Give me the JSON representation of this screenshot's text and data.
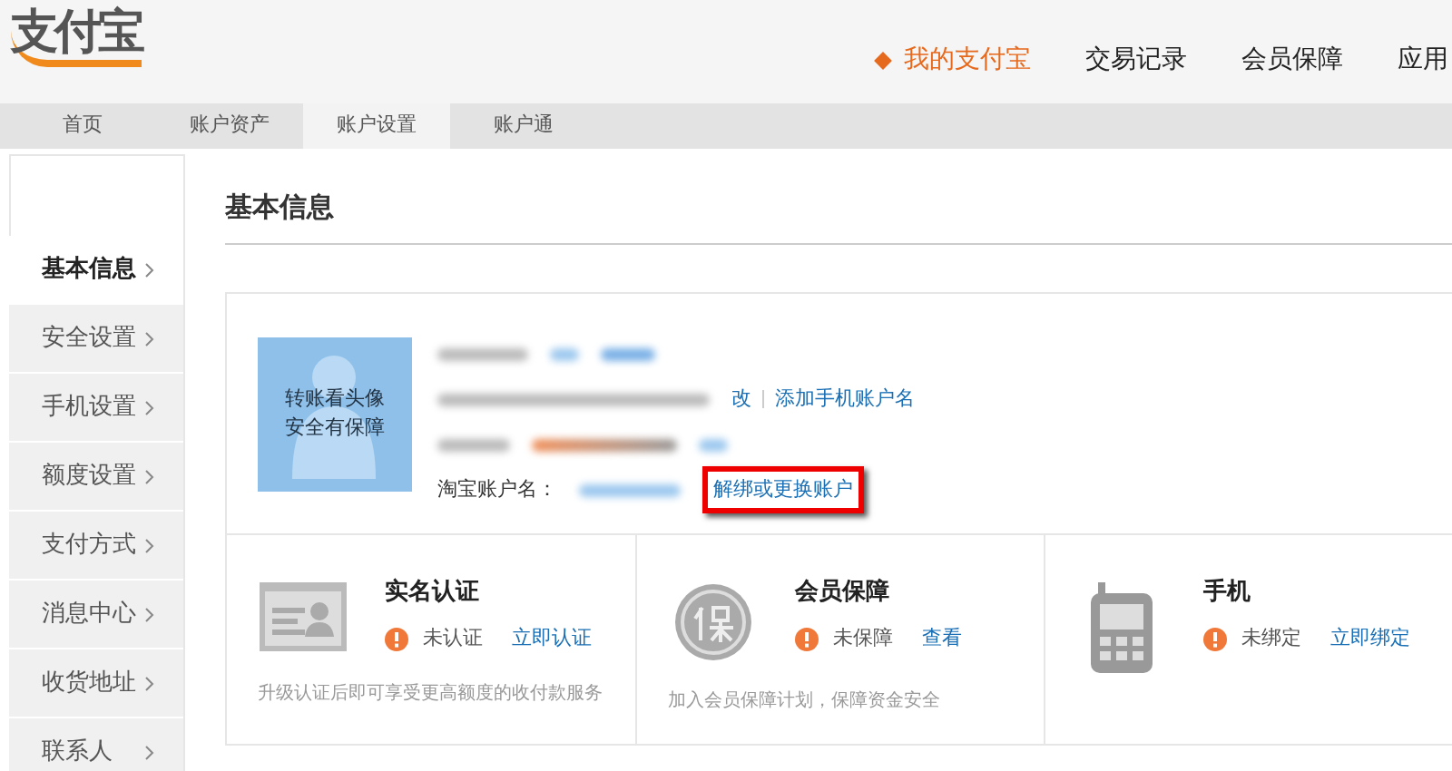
{
  "logo": {
    "text": "支付宝"
  },
  "main_nav": [
    {
      "label": "我的支付宝",
      "selected": true
    },
    {
      "label": "交易记录",
      "selected": false
    },
    {
      "label": "会员保障",
      "selected": false
    },
    {
      "label": "应用",
      "selected": false
    }
  ],
  "sub_nav": [
    {
      "label": "首页",
      "selected": false
    },
    {
      "label": "账户资产",
      "selected": false
    },
    {
      "label": "账户设置",
      "selected": true
    },
    {
      "label": "账户通",
      "selected": false
    }
  ],
  "sidebar": {
    "items": [
      {
        "label": "基本信息",
        "selected": true
      },
      {
        "label": "安全设置",
        "selected": false
      },
      {
        "label": "手机设置",
        "selected": false
      },
      {
        "label": "额度设置",
        "selected": false
      },
      {
        "label": "支付方式",
        "selected": false
      },
      {
        "label": "消息中心",
        "selected": false
      },
      {
        "label": "收货地址",
        "selected": false
      },
      {
        "label": "联系人",
        "selected": false
      }
    ]
  },
  "page_title": "基本信息",
  "profile": {
    "avatar_text": "转账看头像安全有保障",
    "rows": [
      {
        "links": []
      },
      {
        "links": [
          "改",
          "添加手机账户名"
        ]
      },
      {
        "links": []
      },
      {
        "label": "淘宝账户名：",
        "links": [
          "解绑或更换账户"
        ],
        "highlighted_link": true
      }
    ]
  },
  "cards": [
    {
      "kind": "id",
      "title": "实名认证",
      "status": "未认证",
      "action": "立即认证",
      "description": "升级认证后即可享受更高额度的收付款服务"
    },
    {
      "kind": "shield",
      "title": "会员保障",
      "status": "未保障",
      "action": "查看",
      "description": "加入会员保障计划，保障资金安全"
    },
    {
      "kind": "phone",
      "title": "手机",
      "status": "未绑定",
      "action": "立即绑定"
    }
  ]
}
